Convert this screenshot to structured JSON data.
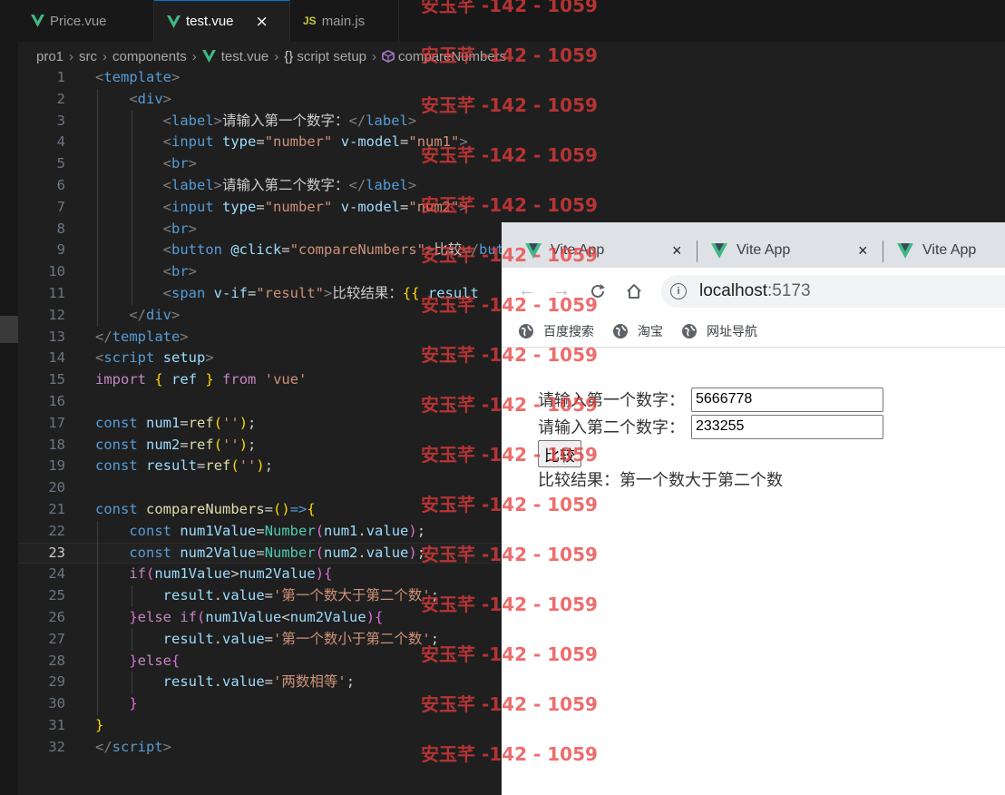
{
  "editor": {
    "tabs": [
      {
        "label": "Price.vue",
        "icon": "vue-icon",
        "active": false
      },
      {
        "label": "test.vue",
        "icon": "vue-icon",
        "active": true,
        "close": "×"
      },
      {
        "label": "main.js",
        "icon": "js-icon",
        "active": false
      }
    ],
    "js_icon_text": "JS",
    "breadcrumb": [
      "pro1",
      "src",
      "components",
      "test.vue",
      "script setup",
      "compareNumbers"
    ],
    "breadcrumb_braces": "{}",
    "line_numbers": [
      "1",
      "2",
      "3",
      "4",
      "5",
      "6",
      "7",
      "8",
      "9",
      "10",
      "11",
      "12",
      "13",
      "14",
      "15",
      "16",
      "17",
      "18",
      "19",
      "20",
      "21",
      "22",
      "23",
      "24",
      "25",
      "26",
      "27",
      "28",
      "29",
      "30",
      "31",
      "32"
    ],
    "current_line": 23,
    "colors": {
      "background": "#1f1f1f",
      "accent": "#0078d4",
      "vue_green": "#41b883"
    }
  },
  "code_tokens": {
    "template_tag": "template",
    "div_tag": "div",
    "label_tag": "label",
    "input_tag": "input",
    "br_tag": "br",
    "button_tag": "button",
    "span_tag": "span",
    "script_tag": "script",
    "attr_type": "type",
    "attr_vmodel": "v-model",
    "attr_click": "@click",
    "attr_vif": "v-if",
    "attr_setup": "setup",
    "str_number": "\"number\"",
    "str_num1": "\"num1\"",
    "str_num2": "\"num2\"",
    "str_compare": "\"compareNumbers\"",
    "str_result": "\"result\"",
    "str_vue": "'vue'",
    "str_empty": "''",
    "str_gt": "'第一个数大于第二个数'",
    "str_lt": "'第一个数小于第二个数'",
    "str_eq": "'两数相等'",
    "text_label1": "请输入第一个数字：",
    "text_label2": "请输入第二个数字：",
    "text_button": "比较",
    "text_result_prefix": "比较结果：",
    "interp_open": "{{",
    "interp_var": "result",
    "kw_import": "import",
    "kw_from": "from",
    "kw_const": "const",
    "kw_if": "if",
    "kw_else": "else",
    "fn_ref": "ref",
    "fn_number": "Number",
    "var_num1": "num1",
    "var_num2": "num2",
    "var_result": "result",
    "var_compare": "compareNumbers",
    "var_num1value": "num1Value",
    "var_num2value": "num2Value",
    "prop_value": "value"
  },
  "browser": {
    "tabs": [
      {
        "title": "Vite App",
        "close": "×"
      },
      {
        "title": "Vite App",
        "close": "×"
      },
      {
        "title": "Vite App"
      }
    ],
    "url_host": "localhost",
    "url_port": ":5173",
    "info_icon_text": "i",
    "bookmarks": [
      "百度搜索",
      "淘宝",
      "网址导航"
    ],
    "form": {
      "label1": "请输入第一个数字：",
      "value1": "5666778",
      "label2": "请输入第二个数字：",
      "value2": "233255",
      "button_label": "比较",
      "result_text": "比较结果：第一个数大于第二个数"
    }
  },
  "watermark": {
    "text": "安玉芊 -142 - 1059",
    "color": "#e83c3c"
  }
}
